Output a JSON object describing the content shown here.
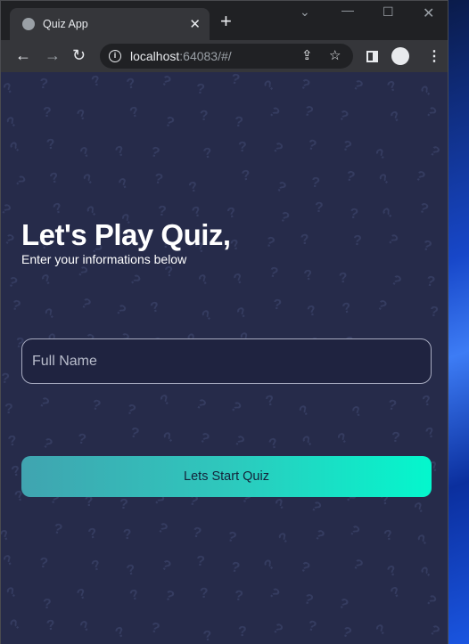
{
  "browser": {
    "tab_title": "Quiz App",
    "url_host": "localhost",
    "url_path": ":64083/#/"
  },
  "page": {
    "title": "Let's Play Quiz,",
    "subtitle": "Enter your informations below",
    "name_placeholder": "Full Name",
    "start_button": "Lets Start Quiz"
  },
  "colors": {
    "background": "#262b4a",
    "button_start": "#40a4b0",
    "button_end": "#04f7cd"
  }
}
